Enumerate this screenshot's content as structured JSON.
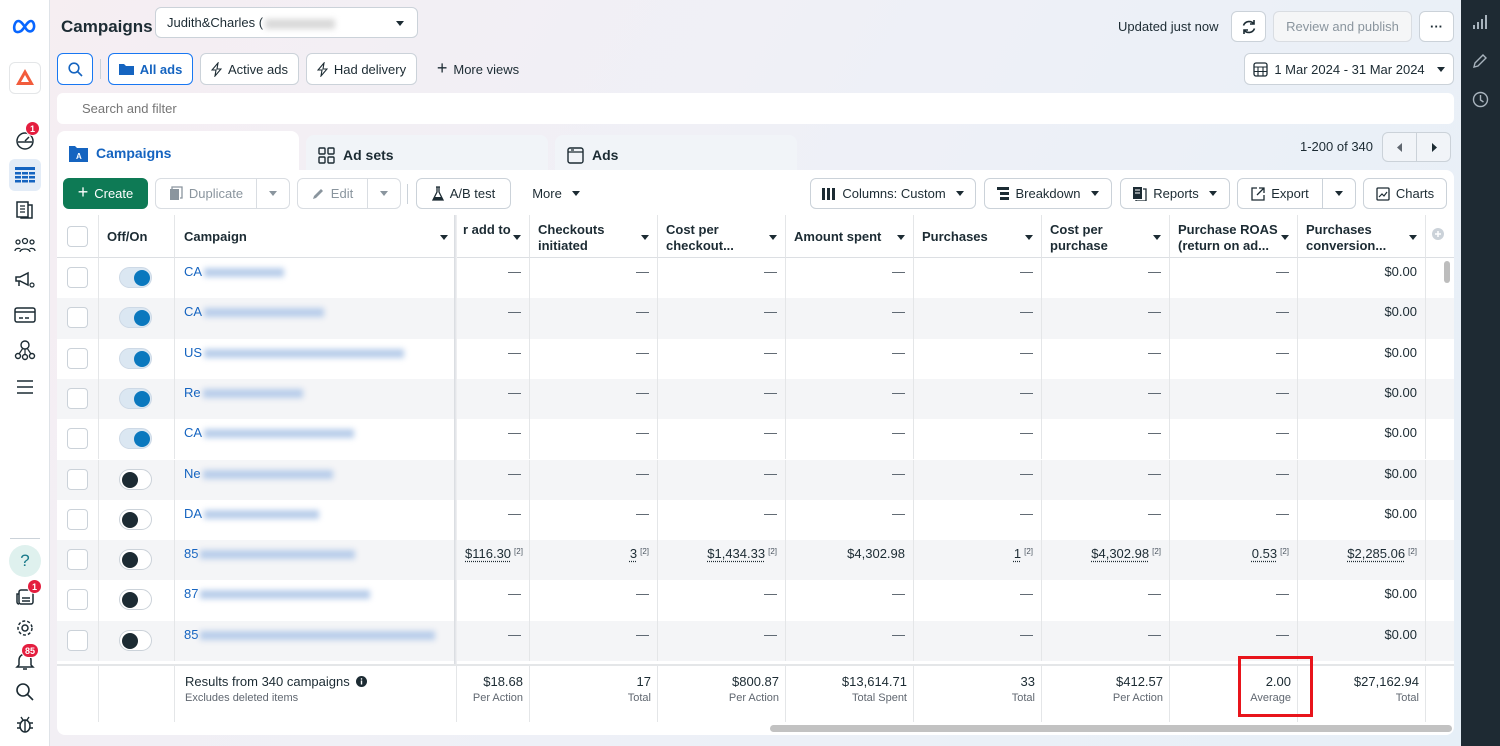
{
  "app": {
    "title": "Campaigns",
    "account_name": "Judith&Charles (",
    "updated_text": "Updated just now",
    "review_publish": "Review and publish",
    "more_menu": "···"
  },
  "left_nav": {
    "items": [
      {
        "name": "meta-logo-icon"
      },
      {
        "name": "app-switcher-icon"
      },
      {
        "name": "dashboard-icon",
        "badge": "1"
      },
      {
        "name": "campaigns-table-icon",
        "active": true
      },
      {
        "name": "pages-icon"
      },
      {
        "name": "audiences-icon"
      },
      {
        "name": "ads-manager-icon"
      },
      {
        "name": "billing-icon"
      },
      {
        "name": "network-icon"
      },
      {
        "name": "menu-icon"
      }
    ],
    "bottom": [
      {
        "name": "help-icon",
        "glyph": "?"
      },
      {
        "name": "news-icon",
        "badge": "1"
      },
      {
        "name": "settings-icon"
      },
      {
        "name": "notifications-icon",
        "badge": "85"
      },
      {
        "name": "search-icon"
      },
      {
        "name": "bug-icon"
      }
    ]
  },
  "views": {
    "all_ads": "All ads",
    "active_ads": "Active ads",
    "had_delivery": "Had delivery",
    "more_views": "More views"
  },
  "date_range": "1 Mar 2024 - 31 Mar 2024",
  "search": {
    "placeholder": "Search and filter"
  },
  "tabs": [
    {
      "label": "Campaigns",
      "active": true
    },
    {
      "label": "Ad sets"
    },
    {
      "label": "Ads"
    }
  ],
  "pager": {
    "text": "1-200 of 340"
  },
  "toolbar": {
    "create": "Create",
    "duplicate": "Duplicate",
    "edit": "Edit",
    "ab_test": "A/B test",
    "more": "More",
    "columns": "Columns: Custom",
    "breakdown": "Breakdown",
    "reports": "Reports",
    "export": "Export",
    "charts": "Charts"
  },
  "table": {
    "headers": {
      "offon": "Off/On",
      "campaign": "Campaign",
      "c1": "r add to",
      "c2a": "Checkouts",
      "c2b": "initiated",
      "c3a": "Cost per",
      "c3b": "checkout...",
      "c4": "Amount spent",
      "c5": "Purchases",
      "c6a": "Cost per",
      "c6b": "purchase",
      "c7a": "Purchase ROAS",
      "c7b": "(return on ad...",
      "c8a": "Purchases",
      "c8b": "conversion..."
    },
    "rows": [
      {
        "on": true,
        "name_prefix": "CA",
        "c1": "—",
        "c2": "—",
        "c3": "—",
        "c4": "—",
        "c5": "—",
        "c6": "—",
        "c7": "—",
        "c8": "$0.00"
      },
      {
        "on": true,
        "name_prefix": "CA",
        "c1": "—",
        "c2": "—",
        "c3": "—",
        "c4": "—",
        "c5": "—",
        "c6": "—",
        "c7": "—",
        "c8": "$0.00"
      },
      {
        "on": true,
        "name_prefix": "US",
        "c1": "—",
        "c2": "—",
        "c3": "—",
        "c4": "—",
        "c5": "—",
        "c6": "—",
        "c7": "—",
        "c8": "$0.00"
      },
      {
        "on": true,
        "name_prefix": "Re",
        "c1": "—",
        "c2": "—",
        "c3": "—",
        "c4": "—",
        "c5": "—",
        "c6": "—",
        "c7": "—",
        "c8": "$0.00"
      },
      {
        "on": true,
        "name_prefix": "CA",
        "c1": "—",
        "c2": "—",
        "c3": "—",
        "c4": "—",
        "c5": "—",
        "c6": "—",
        "c7": "—",
        "c8": "$0.00"
      },
      {
        "on": false,
        "name_prefix": "Ne",
        "c1": "—",
        "c2": "—",
        "c3": "—",
        "c4": "—",
        "c5": "—",
        "c6": "—",
        "c7": "—",
        "c8": "$0.00"
      },
      {
        "on": false,
        "name_prefix": "DA",
        "c1": "—",
        "c2": "—",
        "c3": "—",
        "c4": "—",
        "c5": "—",
        "c6": "—",
        "c7": "—",
        "c8": "$0.00"
      },
      {
        "on": false,
        "name_prefix": "85",
        "c1": "$116.30",
        "c2": "3",
        "c3": "$1,434.33",
        "c4": "$4,302.98",
        "c5": "1",
        "c6": "$4,302.98",
        "c7": "0.53",
        "c8": "$2,285.06",
        "note": "[2]"
      },
      {
        "on": false,
        "name_prefix": "87",
        "c1": "—",
        "c2": "—",
        "c3": "—",
        "c4": "—",
        "c5": "—",
        "c6": "—",
        "c7": "—",
        "c8": "$0.00"
      },
      {
        "on": false,
        "name_prefix": "85",
        "c1": "—",
        "c2": "—",
        "c3": "—",
        "c4": "—",
        "c5": "—",
        "c6": "—",
        "c7": "—",
        "c8": "$0.00"
      }
    ],
    "summary": {
      "title": "Results from 340 campaigns",
      "subtitle": "Excludes deleted items",
      "c1": {
        "value": "$18.68",
        "label": "Per Action"
      },
      "c2": {
        "value": "17",
        "label": "Total"
      },
      "c3": {
        "value": "$800.87",
        "label": "Per Action"
      },
      "c4": {
        "value": "$13,614.71",
        "label": "Total Spent"
      },
      "c5": {
        "value": "33",
        "label": "Total"
      },
      "c6": {
        "value": "$412.57",
        "label": "Per Action"
      },
      "c7": {
        "value": "2.00",
        "label": "Average"
      },
      "c8": {
        "value": "$27,162.94",
        "label": "Total"
      }
    }
  },
  "colors": {
    "accent": "#1564c0",
    "create_green": "#0e7a55",
    "highlight": "#e8141b",
    "toggle_on": "#0a78be"
  }
}
